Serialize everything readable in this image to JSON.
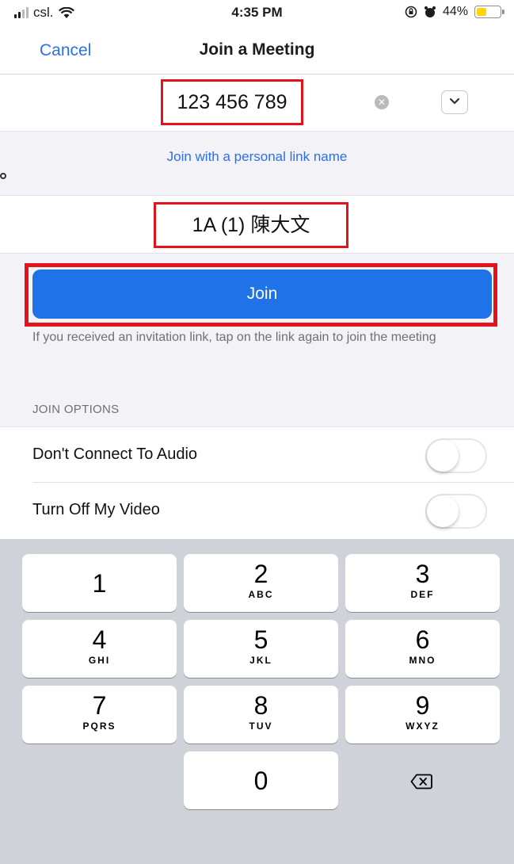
{
  "status_bar": {
    "carrier": "csl.",
    "time": "4:35 PM",
    "battery": "44%",
    "battery_level": 0.44
  },
  "nav": {
    "cancel_label": "Cancel",
    "title": "Join a Meeting"
  },
  "meeting": {
    "meeting_id": "123 456 789",
    "personal_link_label": "Join with a personal link name",
    "stray_char": "。",
    "display_name": "1A (1) 陳大文"
  },
  "join": {
    "button_label": "Join",
    "hint": "If you received an invitation link, tap on the link again to join the meeting"
  },
  "options": {
    "header": "JOIN OPTIONS",
    "items": [
      {
        "label": "Don't Connect To Audio",
        "enabled": false
      },
      {
        "label": "Turn Off My Video",
        "enabled": false
      }
    ]
  },
  "keypad": {
    "keys": [
      {
        "num": "1",
        "letters": ""
      },
      {
        "num": "2",
        "letters": "ABC"
      },
      {
        "num": "3",
        "letters": "DEF"
      },
      {
        "num": "4",
        "letters": "GHI"
      },
      {
        "num": "5",
        "letters": "JKL"
      },
      {
        "num": "6",
        "letters": "MNO"
      },
      {
        "num": "7",
        "letters": "PQRS"
      },
      {
        "num": "8",
        "letters": "TUV"
      },
      {
        "num": "9",
        "letters": "WXYZ"
      },
      {
        "num": "0",
        "letters": ""
      }
    ]
  },
  "colors": {
    "accent": "#1f72e8",
    "link": "#2d6fe6",
    "highlight": "#e3121b",
    "battery_fill": "#ffd60a"
  }
}
